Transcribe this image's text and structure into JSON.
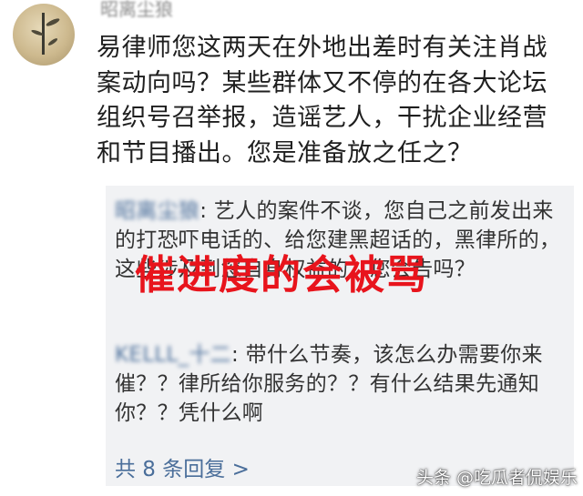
{
  "post": {
    "username": "昭离尘狼",
    "comment": "易律师您这两天在外地出差时有关注肖战案动向吗？某些群体又不停的在各大论坛组织号召举报，造谣艺人，干扰企业经营和节目播出。您是准备放之任之？"
  },
  "replies": [
    {
      "name": "昭离尘狼",
      "separator": ": ",
      "text": "艺人的案件不谈，您自己之前发出来的打恐吓电话的、给您建黑超话的，黑律所的，这些涉及到您自身权益的，您会告吗？"
    },
    {
      "name": "KELLL_十二",
      "separator": ": ",
      "text": "带什么节奏，该怎么办需要你来催？？律所给你服务的？？有什么结果先通知你？？凭什么啊"
    }
  ],
  "view_more": "共 8 条回复 >",
  "overlay_caption": "催进度的会被骂",
  "watermark": "头条 @吃瓜者侃娱乐",
  "colors": {
    "link": "#4a6e9a",
    "reply_bg": "#f1f2f4",
    "caption": "#e8141c"
  },
  "icons": {
    "avatar": "bamboo-painting-avatar"
  }
}
